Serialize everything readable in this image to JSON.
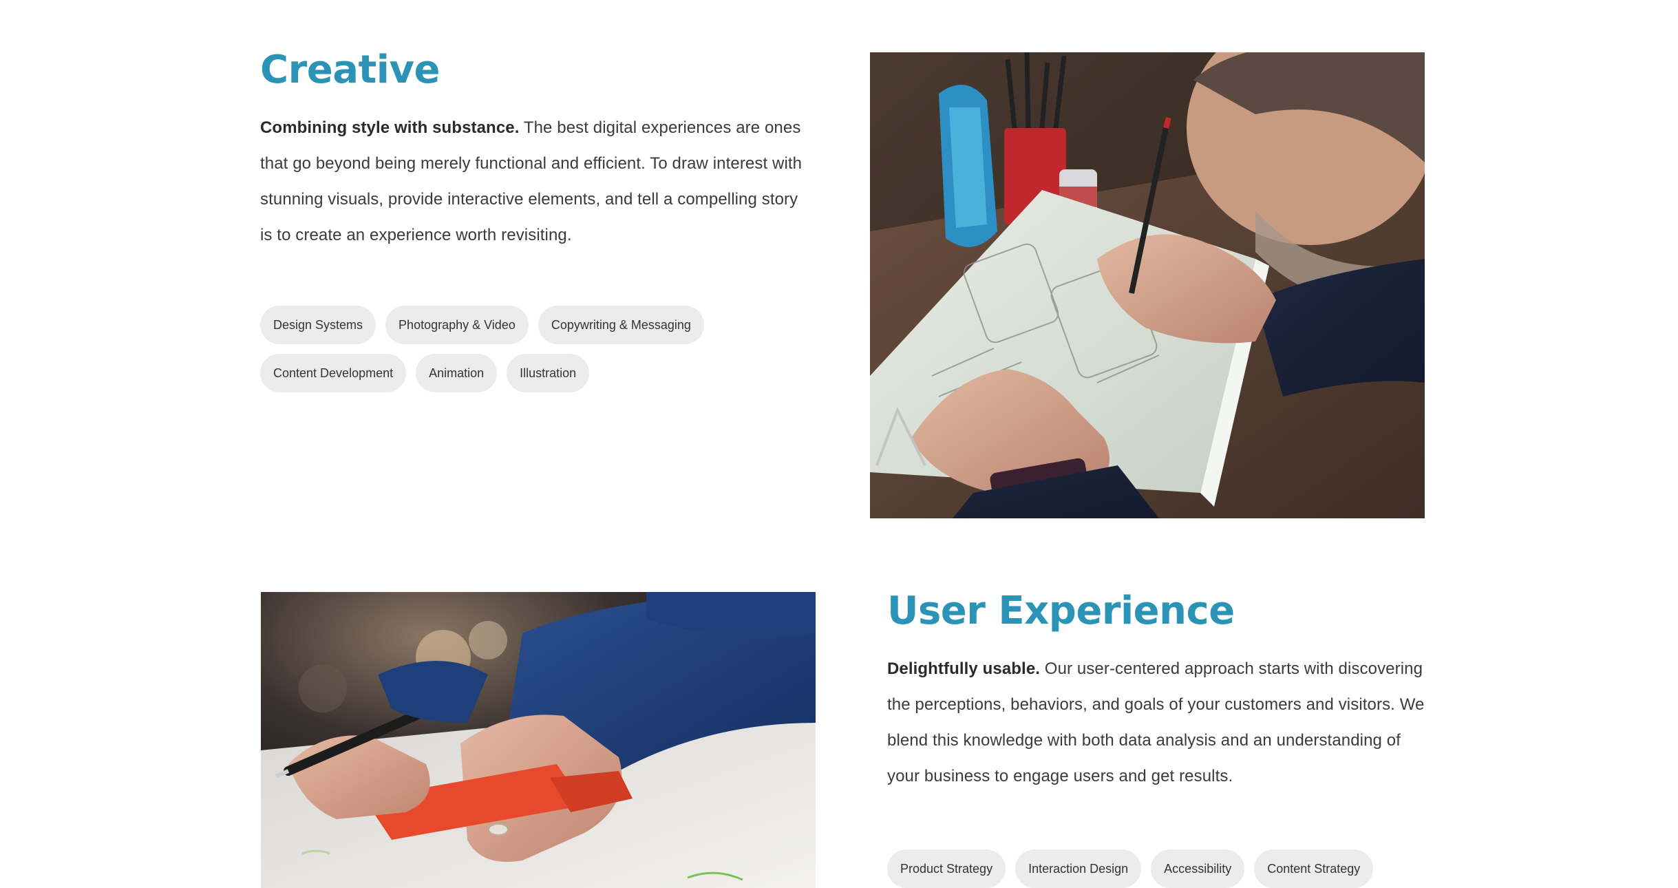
{
  "sections": {
    "creative": {
      "heading": "Creative",
      "lead": "Combining style with substance.",
      "body": " The best digital experiences are ones that go beyond being merely functional and efficient. To draw interest with stunning visuals, provide interactive elements, and tell a compelling story is to create an experience worth revisiting.",
      "tags": [
        "Design Systems",
        "Photography & Video",
        "Copywriting & Messaging",
        "Content Development",
        "Animation",
        "Illustration"
      ]
    },
    "ux": {
      "heading": "User Experience",
      "lead": "Delightfully usable.",
      "body": " Our user-centered approach starts with discovering the perceptions, behaviors, and goals of your customers and visitors. We blend this knowledge with both data analysis and an understanding of your business to engage users and get results.",
      "tags": [
        "Product Strategy",
        "Interaction Design",
        "Accessibility",
        "Content Strategy"
      ]
    }
  },
  "colors": {
    "heading": "#2b93b6",
    "tag_bg": "#ececec",
    "body_text": "#3a3a3f"
  }
}
